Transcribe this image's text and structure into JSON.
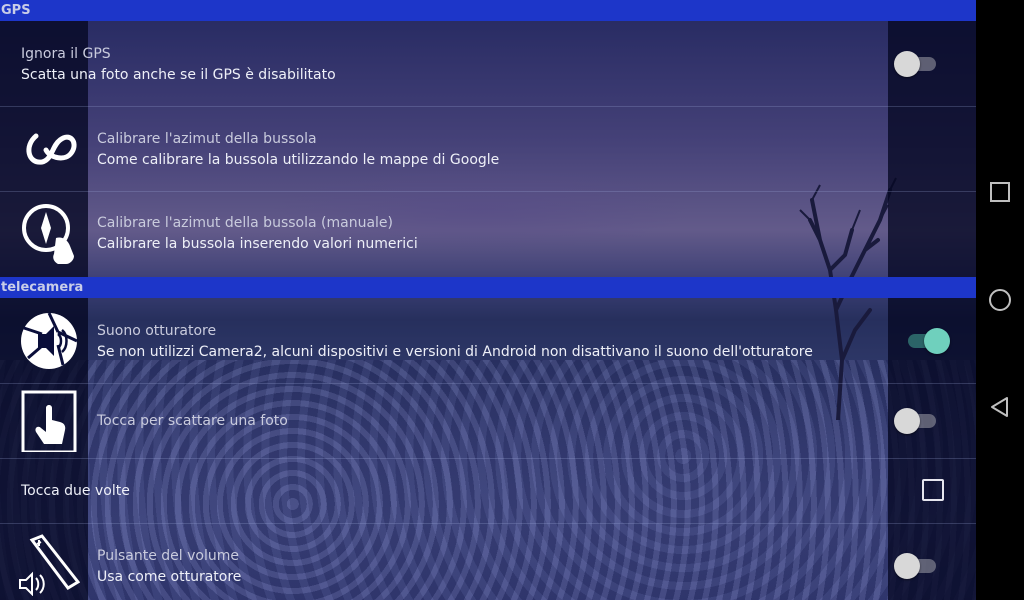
{
  "categories": {
    "gps": "GPS",
    "camera": "telecamera"
  },
  "gps": {
    "ignore_gps": {
      "title": "Ignora il GPS",
      "summary": "Scatta una foto anche se il GPS è disabilitato",
      "enabled": false
    },
    "calibrate_compass": {
      "title": "Calibrare l'azimut della bussola",
      "summary": "Come calibrare la bussola utilizzando le mappe di Google",
      "icon": "infinity-figure-eight-icon"
    },
    "calibrate_compass_manual": {
      "title": "Calibrare l'azimut della bussola (manuale)",
      "summary": "Calibrare la bussola inserendo valori numerici",
      "icon": "compass-hand-icon"
    }
  },
  "camera": {
    "shutter_sound": {
      "title": "Suono otturatore",
      "summary": "Se non utilizzi Camera2, alcuni dispositivi e versioni di Android non disattivano il suono dell'otturatore",
      "enabled": true,
      "icon": "camera-shutter-sound-icon"
    },
    "touch_to_shoot": {
      "title": "Tocca per scattare una foto",
      "enabled": false,
      "icon": "touch-screen-icon"
    },
    "double_tap": {
      "title": "Tocca due volte",
      "checked": false
    },
    "volume_button": {
      "title": "Pulsante del volume",
      "summary": "Usa come otturatore",
      "enabled": false,
      "icon": "volume-button-icon"
    }
  },
  "colors": {
    "category_bar": "#1d36c9",
    "switch_on": "#6fd0bd",
    "switch_off": "#d8d8d8"
  },
  "navigation": {
    "recents": "recents-square-icon",
    "home": "home-circle-icon",
    "back": "back-triangle-icon"
  }
}
